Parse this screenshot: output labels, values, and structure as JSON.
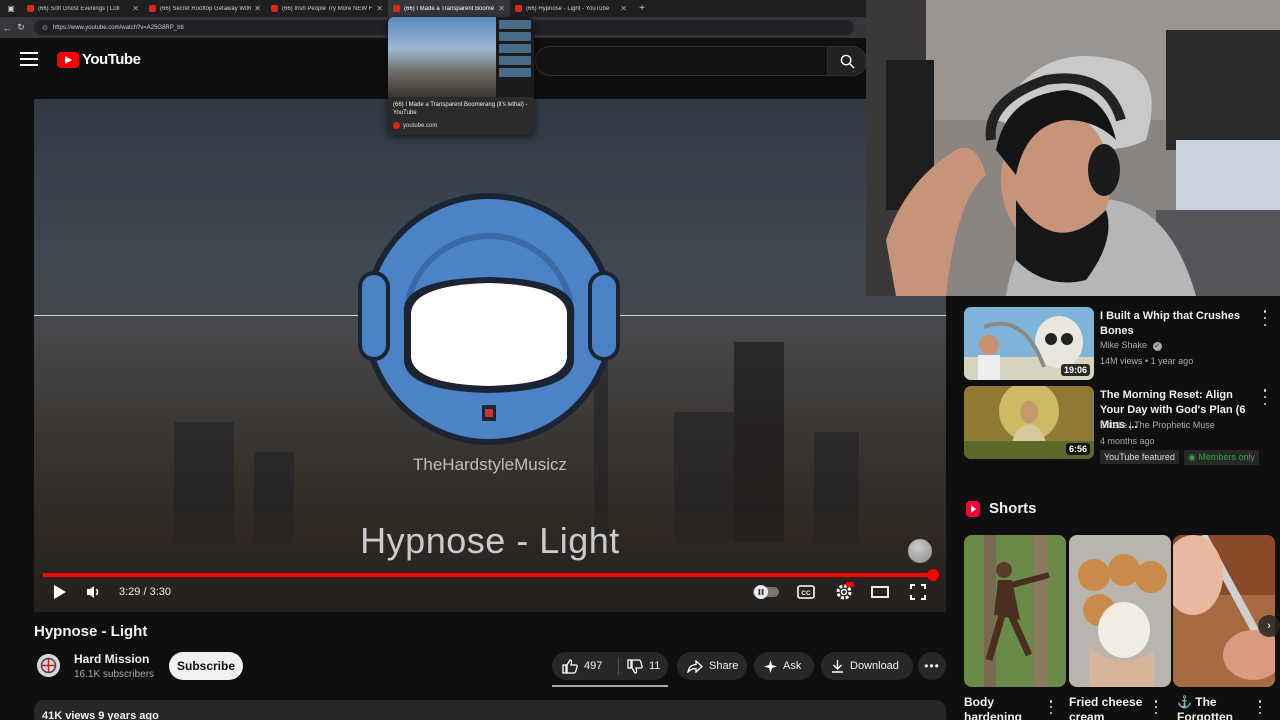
{
  "browser": {
    "tabs": [
      {
        "label": "(66) Soft Ghost Evenings | Lofi",
        "active": false
      },
      {
        "label": "(66) Secret Rooftop Getaway With",
        "active": false
      },
      {
        "label": "(66) Irish People Try More NEW F",
        "active": false
      },
      {
        "label": "(66) I Made a Transparent Boome",
        "active": true
      },
      {
        "label": "(66) Hypnose - Light - YouTube",
        "active": false
      }
    ],
    "new_tab": "+",
    "url": "https://www.youtube.com/watch?v=A25G8RP_btI",
    "tab_preview": {
      "title": "(66) I Made a Transparent Boomerang (it's lethal) - YouTube",
      "domain": "youtube.com"
    }
  },
  "youtube": {
    "logo_text": "YouTube",
    "icons": {
      "menu": "hamburger-icon",
      "search": "search-icon"
    }
  },
  "player": {
    "channel_watermark_text": "TheHardstyleMusicz",
    "overlay_title": "Hypnose - Light",
    "time": "3:29 / 3:30",
    "progress": 0.995,
    "icons": [
      "play-icon",
      "volume-icon",
      "autoplay-toggle-icon",
      "captions-icon",
      "settings-icon",
      "theater-icon",
      "fullscreen-icon"
    ]
  },
  "video": {
    "title": "Hypnose - Light",
    "channel": "Hard Mission",
    "subscribers": "16.1K subscribers",
    "subscribe_label": "Subscribe",
    "likes": "497",
    "dislikes": "11",
    "share_label": "Share",
    "ask_label": "Ask",
    "download_label": "Download",
    "views_date": "41K views  9 years ago"
  },
  "recommendations": [
    {
      "title": "I Built a Whip that Crushes Bones",
      "channel": "Mike Shake",
      "verified": true,
      "meta": "14M views • 1 year ago",
      "duration": "19:06"
    },
    {
      "title": "The Morning Reset: Align Your Day with God's Plan (6 Mins ...",
      "channel": "Estelle | The Prophetic Muse",
      "meta": "4 months ago",
      "duration": "6:56",
      "badges": [
        "YouTube featured",
        "Members only"
      ]
    }
  ],
  "shorts": {
    "heading": "Shorts",
    "items": [
      {
        "title": "Body hardening"
      },
      {
        "title": "Fried cheese cream"
      },
      {
        "title": "⚓ The Forgotten"
      }
    ]
  },
  "colors": {
    "accent": "#ff0000",
    "background": "#0f0f0f",
    "members": "#2ba640"
  }
}
